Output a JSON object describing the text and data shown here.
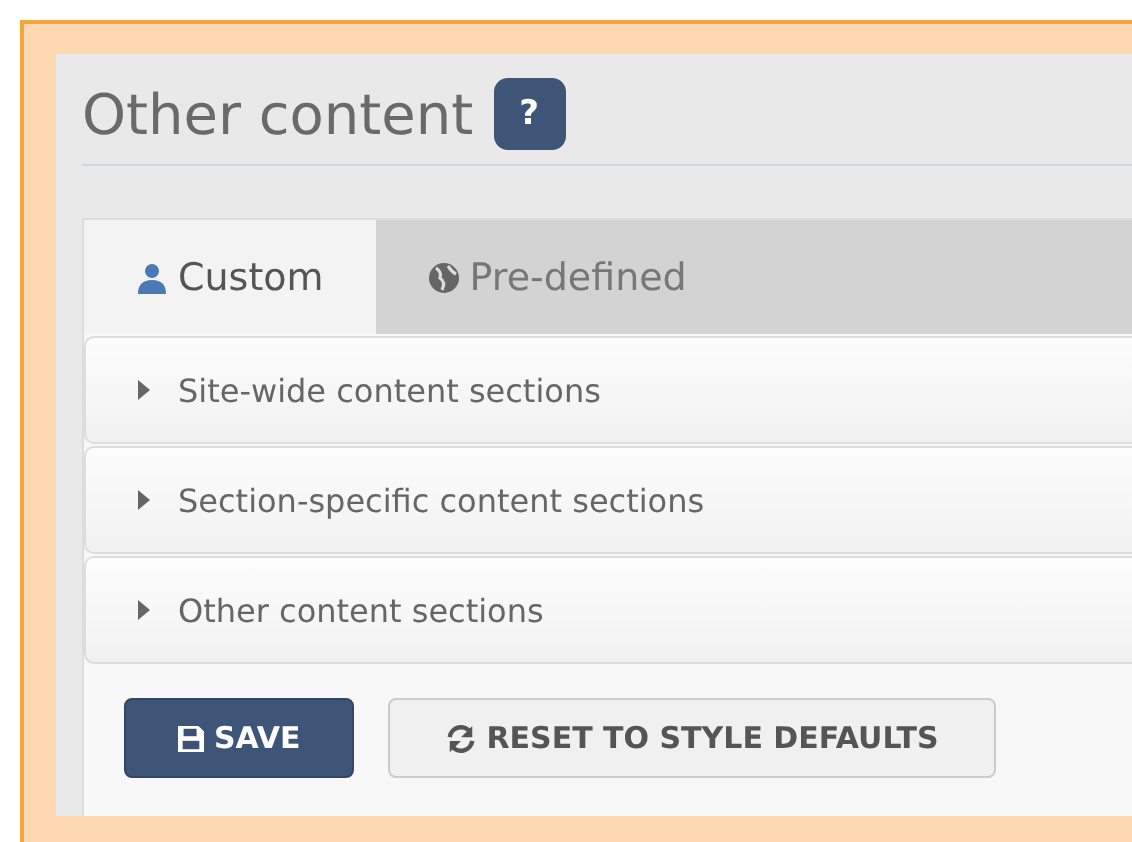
{
  "heading": {
    "title": "Other content",
    "help": "?"
  },
  "tabs": [
    {
      "label": "Custom",
      "kind": "user",
      "selected": true
    },
    {
      "label": "Pre-defined",
      "kind": "globe",
      "selected": false
    }
  ],
  "sections": [
    {
      "label": "Site-wide content sections",
      "expanded": false
    },
    {
      "label": "Section-specific content sections",
      "expanded": false
    },
    {
      "label": "Other content sections",
      "expanded": false
    }
  ],
  "buttons": [
    {
      "label": "SAVE",
      "kind": "primary"
    },
    {
      "label": "RESET TO STYLE DEFAULTS",
      "kind": "secondary"
    }
  ]
}
